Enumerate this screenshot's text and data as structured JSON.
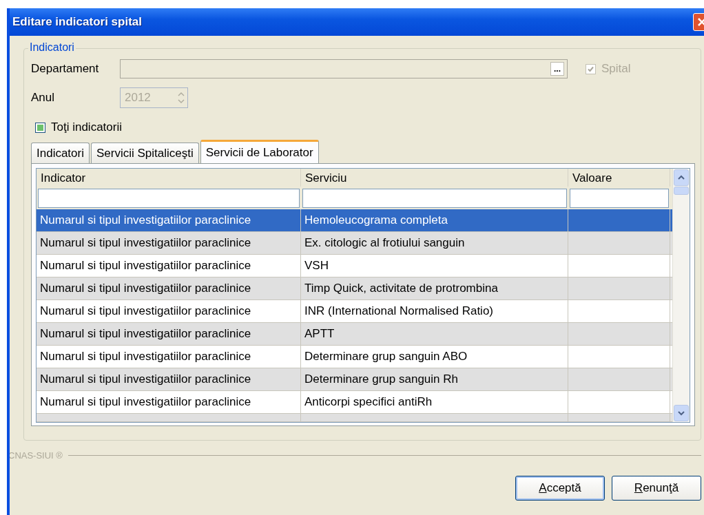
{
  "window": {
    "title": "Editare indicatori spital"
  },
  "group": {
    "title": "Indicatori"
  },
  "department": {
    "label": "Departament",
    "browse": "...",
    "disabled": true
  },
  "hospital": {
    "label": "Spital",
    "checked": true,
    "disabled": true
  },
  "year": {
    "label": "Anul",
    "value": "2012",
    "disabled": true
  },
  "all_indicators": {
    "label": "Toţi indicatorii",
    "checked": true
  },
  "tabs": [
    {
      "label": "Indicatori",
      "selected": false
    },
    {
      "label": "Servicii Spitaliceşti",
      "selected": false
    },
    {
      "label": "Servicii de Laborator",
      "selected": true
    }
  ],
  "table": {
    "columns": [
      "Indicator",
      "Serviciu",
      "Valoare"
    ],
    "rows": [
      {
        "indicator": "Numarul si tipul investigatiilor paraclinice",
        "service": "Hemoleucograma completa",
        "selected": true
      },
      {
        "indicator": "Numarul si tipul investigatiilor paraclinice",
        "service": "Ex. citologic al frotiului sanguin",
        "selected": false
      },
      {
        "indicator": "Numarul si tipul investigatiilor paraclinice",
        "service": "VSH",
        "selected": false
      },
      {
        "indicator": "Numarul si tipul investigatiilor paraclinice",
        "service": "Timp Quick, activitate de protrombina",
        "selected": false
      },
      {
        "indicator": "Numarul si tipul investigatiilor paraclinice",
        "service": "INR (International Normalised Ratio)",
        "selected": false
      },
      {
        "indicator": "Numarul si tipul investigatiilor paraclinice",
        "service": "APTT",
        "selected": false
      },
      {
        "indicator": "Numarul si tipul investigatiilor paraclinice",
        "service": "Determinare grup sanguin ABO",
        "selected": false
      },
      {
        "indicator": "Numarul si tipul investigatiilor paraclinice",
        "service": "Determinare grup sanguin Rh",
        "selected": false
      },
      {
        "indicator": "Numarul si tipul investigatiilor paraclinice",
        "service": "Anticorpi specifici antiRh",
        "selected": false
      }
    ]
  },
  "footer": {
    "brand": "CNAS-SIUI ®"
  },
  "buttons": [
    {
      "label": "Acceptă",
      "default": true
    },
    {
      "label": "Renunţă",
      "default": false
    }
  ]
}
